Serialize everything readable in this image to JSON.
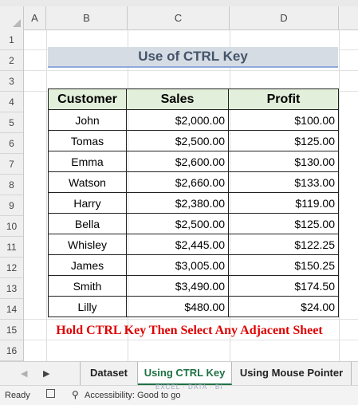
{
  "columns": [
    "A",
    "B",
    "C",
    "D"
  ],
  "rows": [
    "1",
    "2",
    "3",
    "4",
    "5",
    "6",
    "7",
    "8",
    "9",
    "10",
    "11",
    "12",
    "13",
    "14",
    "15",
    "16"
  ],
  "title": "Use of CTRL Key",
  "table": {
    "headers": {
      "customer": "Customer",
      "sales": "Sales",
      "profit": "Profit"
    },
    "rows": [
      {
        "customer": "John",
        "sales": "$2,000.00",
        "profit": "$100.00"
      },
      {
        "customer": "Tomas",
        "sales": "$2,500.00",
        "profit": "$125.00"
      },
      {
        "customer": "Emma",
        "sales": "$2,600.00",
        "profit": "$130.00"
      },
      {
        "customer": "Watson",
        "sales": "$2,660.00",
        "profit": "$133.00"
      },
      {
        "customer": "Harry",
        "sales": "$2,380.00",
        "profit": "$119.00"
      },
      {
        "customer": "Bella",
        "sales": "$2,500.00",
        "profit": "$125.00"
      },
      {
        "customer": "Whisley",
        "sales": "$2,445.00",
        "profit": "$122.25"
      },
      {
        "customer": "James",
        "sales": "$3,005.00",
        "profit": "$150.25"
      },
      {
        "customer": "Smith",
        "sales": "$3,490.00",
        "profit": "$174.50"
      },
      {
        "customer": "Lilly",
        "sales": "$480.00",
        "profit": "$24.00"
      }
    ]
  },
  "note": "Hold CTRL Key Then Select Any Adjacent Sheet",
  "sheet_tabs": [
    "Dataset",
    "Using CTRL Key",
    "Using Mouse Pointer"
  ],
  "active_tab": "Using CTRL Key",
  "status": {
    "ready": "Ready",
    "accessibility": "Accessibility: Good to go"
  },
  "watermark": "EXCEL · DATA · BI",
  "colors": {
    "accent": "#1e7145",
    "title_fill": "#d6dce4",
    "header_fill": "#e2efda",
    "note": "#e00000"
  }
}
